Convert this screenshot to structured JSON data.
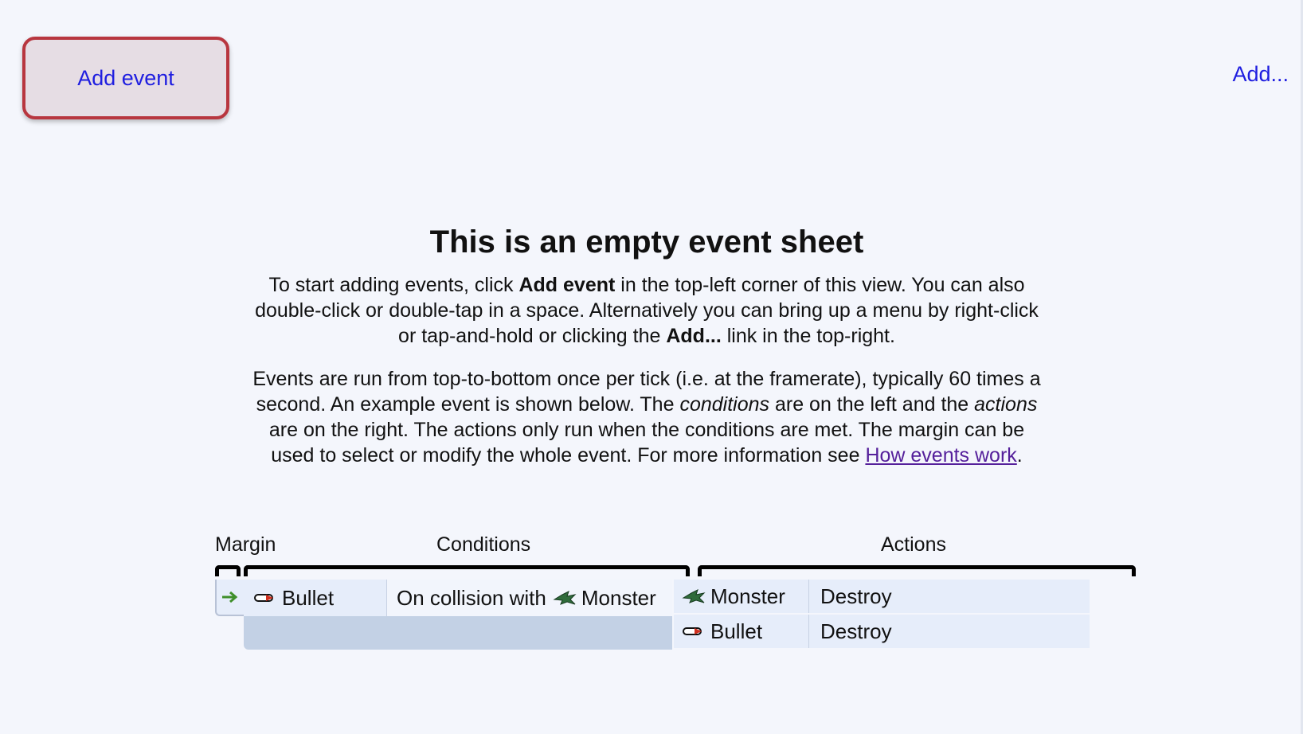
{
  "toolbar": {
    "add_event_label": "Add event",
    "add_menu_label": "Add..."
  },
  "intro": {
    "title": "This is an empty event sheet",
    "p1_a": "To start adding events, click ",
    "p1_b": "Add event",
    "p1_c": " in the top-left corner of this view. You can also double-click or double-tap in a space. Alternatively you can bring up a menu by right-click or tap-and-hold or clicking the ",
    "p1_d": "Add...",
    "p1_e": " link in the top-right.",
    "p2_a": "Events are run from top-to-bottom once per tick (i.e. at the framerate), typically 60 times a second. An example event is shown below. The ",
    "p2_b": "conditions",
    "p2_c": " are on the left and the ",
    "p2_d": "actions",
    "p2_e": " are on the right. The actions only run when the conditions are met. The margin can be used to select or modify the whole event. For more information see ",
    "p2_link": "How events work",
    "p2_end": "."
  },
  "example": {
    "margin_label": "Margin",
    "conditions_label": "Conditions",
    "actions_label": "Actions",
    "condition": {
      "object": "Bullet",
      "object_icon": "bullet-icon",
      "text": "On collision with",
      "target_icon": "monster-icon",
      "target": "Monster"
    },
    "actions": [
      {
        "object": "Monster",
        "object_icon": "monster-icon",
        "action": "Destroy"
      },
      {
        "object": "Bullet",
        "object_icon": "bullet-icon",
        "action": "Destroy"
      }
    ],
    "colors": {
      "row": "#e6edfa",
      "selected_band": "#c3d1e5",
      "margin_arrow": "#3f8f2a"
    }
  }
}
